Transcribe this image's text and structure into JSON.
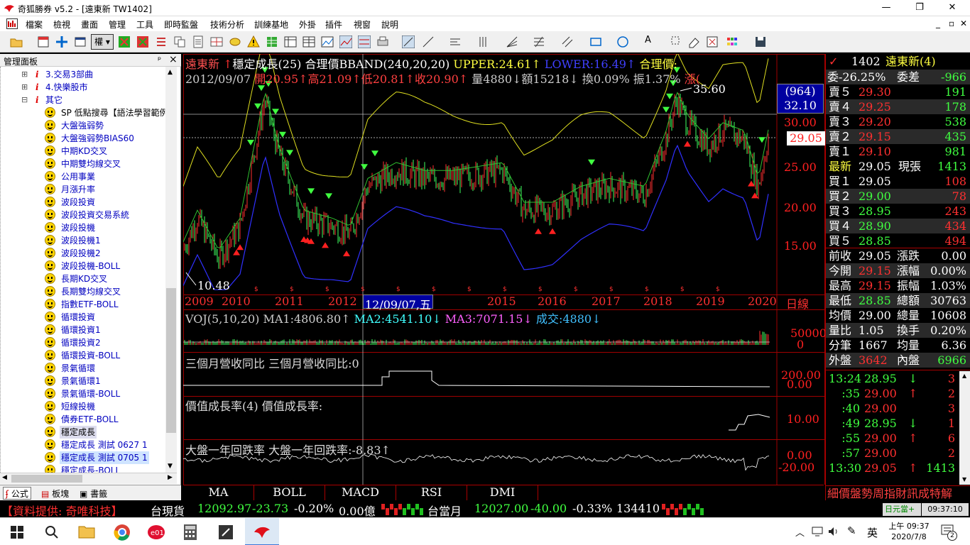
{
  "window": {
    "title": "奇狐勝券 v5.2 - [遠東新 TW1402]",
    "min": "—",
    "max": "❐",
    "close": "✕"
  },
  "menu": [
    "檔案",
    "檢視",
    "畫面",
    "管理",
    "工具",
    "即時監盤",
    "技術分析",
    "訓練基地",
    "外掛",
    "插件",
    "視窗",
    "說明"
  ],
  "menu_right": [
    "_",
    "▫",
    "✕"
  ],
  "sidebar": {
    "header": "管理面板",
    "pin": "ᵖ",
    "close": "×",
    "folders": [
      {
        "label": "3.交易3部曲"
      },
      {
        "label": "4.快樂股市"
      },
      {
        "label": "其它"
      }
    ],
    "items": [
      "SP 低點搜尋【語法學習範例",
      "大盤強弱勢",
      "大盤強弱勢BIAS60",
      "中期KD交叉",
      "中期雙均線交叉",
      "公用事業",
      "月漲升率",
      "波段投資",
      "波段投資交易系統",
      "波段投機",
      "波段投機1",
      "波段投機2",
      "波段投機-BOLL",
      "長期KD交叉",
      "長期雙均線交叉",
      "指數ETF-BOLL",
      "循環投資",
      "循環投資1",
      "循環投資2",
      "循環投資-BOLL",
      "景氣循環",
      "景氣循環1",
      "景氣循環-BOLL",
      "短線投機",
      "債券ETF-BOLL",
      "穩定成長",
      "穩定成長 測試 0627 1",
      "穩定成長 測試 0705 1",
      "穩定成長-BOLL"
    ],
    "tabs": [
      "公式",
      "板塊",
      "書籤"
    ]
  },
  "chart": {
    "header1": {
      "name": "遠東新",
      "arrow": "↑",
      "strategy": "穩定成長(25)",
      "indicator": "合理價BBAND(240,20,20)",
      "upper": "UPPER:24.61↑",
      "lower": "LOWER:16.49↑",
      "fair": "合理價:"
    },
    "header2": {
      "date": "2012/09/07",
      "open": "開20.95↑",
      "high": "高21.09↑",
      "low": "低20.81↑",
      "close": "收20.90↑",
      "vol": "量4880↓",
      "amt": "額15218↓",
      "turn": "換0.09%",
      "amp": "振1.37%",
      "chg": "漲("
    },
    "price_axis": [
      "30.00",
      "25.00",
      "20.00",
      "15.00"
    ],
    "box_top": "(964)",
    "box_price": "32.10",
    "last_price": "29.05",
    "max_label": "35.60",
    "min_label": "10.48",
    "years": [
      "2009",
      "2010",
      "2011",
      "2012",
      "014",
      "2015",
      "2016",
      "2017",
      "2018",
      "2019",
      "2020"
    ],
    "cursor_date": "12/09/07,五",
    "period": "日線",
    "vol_header": {
      "name": "VOJ(5,10,20)",
      "ma1": "MA1:4806.80↑",
      "ma2": "MA2:4541.10↓",
      "ma3": "MA3:7071.15↓",
      "deal": "成交:4880↓"
    },
    "vol_axis": [
      "50000",
      "0"
    ],
    "rev_header": {
      "name": "三個月營收同比",
      "val": "三個月營收同比:0"
    },
    "rev_axis": [
      "200.00",
      "0.00"
    ],
    "growth_header": {
      "name": "價值成長率(4)",
      "val": "價值成長率:"
    },
    "growth_axis": [
      "10.00"
    ],
    "mkt_header": {
      "name": "大盤一年回跌率",
      "val": "大盤一年回跌率:-8.83↑"
    },
    "mkt_axis": [
      "0.00",
      "-20.00"
    ],
    "tabs": [
      "MA",
      "BOLL",
      "MACD",
      "RSI",
      "DMI"
    ]
  },
  "quote": {
    "code": "1402",
    "name": "遠東新(4)",
    "wei_bi": "委-26.25%",
    "wei_cha_label": "委差",
    "wei_cha": "-966",
    "asks": [
      {
        "l": "賣５",
        "p": "29.30",
        "v": "191"
      },
      {
        "l": "賣４",
        "p": "29.25",
        "v": "178"
      },
      {
        "l": "賣３",
        "p": "29.20",
        "v": "538"
      },
      {
        "l": "賣２",
        "p": "29.15",
        "v": "435"
      },
      {
        "l": "賣１",
        "p": "29.10",
        "v": "981"
      }
    ],
    "last": {
      "l": "最新",
      "p": "29.05",
      "l2": "現張",
      "v": "1413"
    },
    "bids": [
      {
        "l": "買１",
        "p": "29.05",
        "v": "108"
      },
      {
        "l": "買２",
        "p": "29.00",
        "v": "78"
      },
      {
        "l": "買３",
        "p": "28.95",
        "v": "243"
      },
      {
        "l": "買４",
        "p": "28.90",
        "v": "434"
      },
      {
        "l": "買５",
        "p": "28.85",
        "v": "494"
      }
    ],
    "stats": [
      {
        "a": "前收",
        "av": "29.05",
        "b": "漲跌",
        "bv": "0.00"
      },
      {
        "a": "今開",
        "av": "29.15",
        "b": "漲幅",
        "bv": "0.00%"
      },
      {
        "a": "最高",
        "av": "29.15",
        "b": "振幅",
        "bv": "1.03%"
      },
      {
        "a": "最低",
        "av": "28.85",
        "b": "總額",
        "bv": "30763"
      },
      {
        "a": "均價",
        "av": "29.00",
        "b": "總量",
        "bv": "10608"
      },
      {
        "a": "量比",
        "av": "1.05",
        "b": "換手",
        "bv": "0.20%"
      },
      {
        "a": "分筆",
        "av": "1667",
        "b": "均量",
        "bv": "6.36"
      },
      {
        "a": "外盤",
        "av": "3642",
        "b": "內盤",
        "bv": "6966"
      }
    ],
    "ticks": [
      {
        "t": "13:24",
        "p": "28.95",
        "a": "↓",
        "v": "3"
      },
      {
        "t": ":35",
        "p": "29.00",
        "a": "↑",
        "v": "2"
      },
      {
        "t": ":40",
        "p": "29.00",
        "a": "",
        "v": "3"
      },
      {
        "t": ":49",
        "p": "28.95",
        "a": "↓",
        "v": "1"
      },
      {
        "t": ":55",
        "p": "29.00",
        "a": "↑",
        "v": "6"
      },
      {
        "t": ":57",
        "p": "29.00",
        "a": "",
        "v": "2"
      },
      {
        "t": "13:30",
        "p": "29.05",
        "a": "↑",
        "v": "1413"
      }
    ],
    "bottom_tabs": "細價盤勢周指財訊成特解"
  },
  "ticker": {
    "provider": "【資料提供: 奇唯科技】",
    "t1_name": "台現貨",
    "t1_val": "12092.97",
    "t1_chg": "-23.73",
    "t1_pct": "-0.20%",
    "t1_amt": "0.00億",
    "t2_name": "台當月",
    "t2_val": "12027.00",
    "t2_chg": "-40.00",
    "t2_pct": "-0.33%",
    "t2_vol": "134410",
    "right1": "日元當+ ↓",
    "time": "09:37:10"
  },
  "taskbar": {
    "ime": "英",
    "time": "上午 09:37",
    "date": "2020/7/8",
    "notif": "2"
  }
}
